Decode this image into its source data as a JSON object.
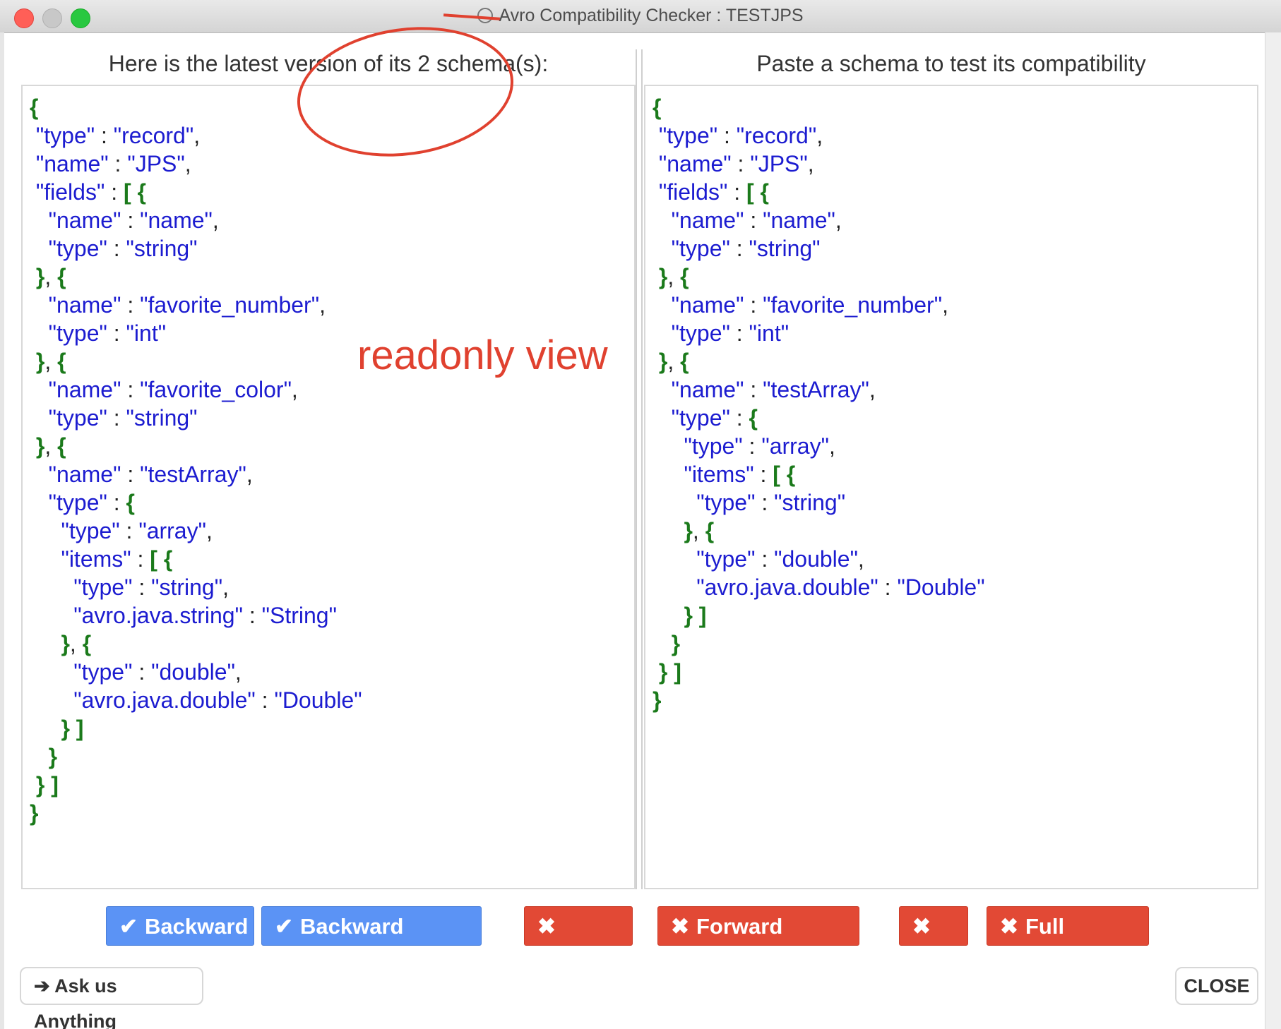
{
  "window": {
    "title": "Avro Compatibility Checker : TESTJPS"
  },
  "left_panel": {
    "header": "Here is the latest version of its 2 schema(s):",
    "code_lines": [
      [
        {
          "t": "p",
          "v": "{"
        }
      ],
      [
        {
          "t": "c",
          "v": " "
        },
        {
          "t": "k",
          "v": "\"type\""
        },
        {
          "t": "c",
          "v": " : "
        },
        {
          "t": "s",
          "v": "\"record\""
        },
        {
          "t": "c",
          "v": ","
        }
      ],
      [
        {
          "t": "c",
          "v": " "
        },
        {
          "t": "k",
          "v": "\"name\""
        },
        {
          "t": "c",
          "v": " : "
        },
        {
          "t": "s",
          "v": "\"JPS\""
        },
        {
          "t": "c",
          "v": ","
        }
      ],
      [
        {
          "t": "c",
          "v": " "
        },
        {
          "t": "k",
          "v": "\"fields\""
        },
        {
          "t": "c",
          "v": " : "
        },
        {
          "t": "p",
          "v": "[ {"
        }
      ],
      [
        {
          "t": "c",
          "v": "   "
        },
        {
          "t": "k",
          "v": "\"name\""
        },
        {
          "t": "c",
          "v": " : "
        },
        {
          "t": "s",
          "v": "\"name\""
        },
        {
          "t": "c",
          "v": ","
        }
      ],
      [
        {
          "t": "c",
          "v": "   "
        },
        {
          "t": "k",
          "v": "\"type\""
        },
        {
          "t": "c",
          "v": " : "
        },
        {
          "t": "s",
          "v": "\"string\""
        }
      ],
      [
        {
          "t": "c",
          "v": " "
        },
        {
          "t": "p",
          "v": "}"
        },
        {
          "t": "c",
          "v": ", "
        },
        {
          "t": "p",
          "v": "{"
        }
      ],
      [
        {
          "t": "c",
          "v": "   "
        },
        {
          "t": "k",
          "v": "\"name\""
        },
        {
          "t": "c",
          "v": " : "
        },
        {
          "t": "s",
          "v": "\"favorite_number\""
        },
        {
          "t": "c",
          "v": ","
        }
      ],
      [
        {
          "t": "c",
          "v": "   "
        },
        {
          "t": "k",
          "v": "\"type\""
        },
        {
          "t": "c",
          "v": " : "
        },
        {
          "t": "s",
          "v": "\"int\""
        }
      ],
      [
        {
          "t": "c",
          "v": " "
        },
        {
          "t": "p",
          "v": "}"
        },
        {
          "t": "c",
          "v": ", "
        },
        {
          "t": "p",
          "v": "{"
        }
      ],
      [
        {
          "t": "c",
          "v": "   "
        },
        {
          "t": "k",
          "v": "\"name\""
        },
        {
          "t": "c",
          "v": " : "
        },
        {
          "t": "s",
          "v": "\"favorite_color\""
        },
        {
          "t": "c",
          "v": ","
        }
      ],
      [
        {
          "t": "c",
          "v": "   "
        },
        {
          "t": "k",
          "v": "\"type\""
        },
        {
          "t": "c",
          "v": " : "
        },
        {
          "t": "s",
          "v": "\"string\""
        }
      ],
      [
        {
          "t": "c",
          "v": " "
        },
        {
          "t": "p",
          "v": "}"
        },
        {
          "t": "c",
          "v": ", "
        },
        {
          "t": "p",
          "v": "{"
        }
      ],
      [
        {
          "t": "c",
          "v": "   "
        },
        {
          "t": "k",
          "v": "\"name\""
        },
        {
          "t": "c",
          "v": " : "
        },
        {
          "t": "s",
          "v": "\"testArray\""
        },
        {
          "t": "c",
          "v": ","
        }
      ],
      [
        {
          "t": "c",
          "v": "   "
        },
        {
          "t": "k",
          "v": "\"type\""
        },
        {
          "t": "c",
          "v": " : "
        },
        {
          "t": "p",
          "v": "{"
        }
      ],
      [
        {
          "t": "c",
          "v": "     "
        },
        {
          "t": "k",
          "v": "\"type\""
        },
        {
          "t": "c",
          "v": " : "
        },
        {
          "t": "s",
          "v": "\"array\""
        },
        {
          "t": "c",
          "v": ","
        }
      ],
      [
        {
          "t": "c",
          "v": "     "
        },
        {
          "t": "k",
          "v": "\"items\""
        },
        {
          "t": "c",
          "v": " : "
        },
        {
          "t": "p",
          "v": "[ {"
        }
      ],
      [
        {
          "t": "c",
          "v": "       "
        },
        {
          "t": "k",
          "v": "\"type\""
        },
        {
          "t": "c",
          "v": " : "
        },
        {
          "t": "s",
          "v": "\"string\""
        },
        {
          "t": "c",
          "v": ","
        }
      ],
      [
        {
          "t": "c",
          "v": "       "
        },
        {
          "t": "k",
          "v": "\"avro.java.string\""
        },
        {
          "t": "c",
          "v": " : "
        },
        {
          "t": "s",
          "v": "\"String\""
        }
      ],
      [
        {
          "t": "c",
          "v": "     "
        },
        {
          "t": "p",
          "v": "}"
        },
        {
          "t": "c",
          "v": ", "
        },
        {
          "t": "p",
          "v": "{"
        }
      ],
      [
        {
          "t": "c",
          "v": "       "
        },
        {
          "t": "k",
          "v": "\"type\""
        },
        {
          "t": "c",
          "v": " : "
        },
        {
          "t": "s",
          "v": "\"double\""
        },
        {
          "t": "c",
          "v": ","
        }
      ],
      [
        {
          "t": "c",
          "v": "       "
        },
        {
          "t": "k",
          "v": "\"avro.java.double\""
        },
        {
          "t": "c",
          "v": " : "
        },
        {
          "t": "s",
          "v": "\"Double\""
        }
      ],
      [
        {
          "t": "c",
          "v": "     "
        },
        {
          "t": "p",
          "v": "} ]"
        }
      ],
      [
        {
          "t": "c",
          "v": "   "
        },
        {
          "t": "p",
          "v": "}"
        }
      ],
      [
        {
          "t": "c",
          "v": " "
        },
        {
          "t": "p",
          "v": "} ]"
        }
      ],
      [
        {
          "t": "p",
          "v": "}"
        }
      ]
    ]
  },
  "right_panel": {
    "header": "Paste a schema to test its compatibility",
    "code_lines": [
      [
        {
          "t": "p",
          "v": "{"
        }
      ],
      [
        {
          "t": "c",
          "v": " "
        },
        {
          "t": "k",
          "v": "\"type\""
        },
        {
          "t": "c",
          "v": " : "
        },
        {
          "t": "s",
          "v": "\"record\""
        },
        {
          "t": "c",
          "v": ","
        }
      ],
      [
        {
          "t": "c",
          "v": " "
        },
        {
          "t": "k",
          "v": "\"name\""
        },
        {
          "t": "c",
          "v": " : "
        },
        {
          "t": "s",
          "v": "\"JPS\""
        },
        {
          "t": "c",
          "v": ","
        }
      ],
      [
        {
          "t": "c",
          "v": " "
        },
        {
          "t": "k",
          "v": "\"fields\""
        },
        {
          "t": "c",
          "v": " : "
        },
        {
          "t": "p",
          "v": "[ {"
        }
      ],
      [
        {
          "t": "c",
          "v": "   "
        },
        {
          "t": "k",
          "v": "\"name\""
        },
        {
          "t": "c",
          "v": " : "
        },
        {
          "t": "s",
          "v": "\"name\""
        },
        {
          "t": "c",
          "v": ","
        }
      ],
      [
        {
          "t": "c",
          "v": "   "
        },
        {
          "t": "k",
          "v": "\"type\""
        },
        {
          "t": "c",
          "v": " : "
        },
        {
          "t": "s",
          "v": "\"string\""
        }
      ],
      [
        {
          "t": "c",
          "v": " "
        },
        {
          "t": "p",
          "v": "}"
        },
        {
          "t": "c",
          "v": ", "
        },
        {
          "t": "p",
          "v": "{"
        }
      ],
      [
        {
          "t": "c",
          "v": "   "
        },
        {
          "t": "k",
          "v": "\"name\""
        },
        {
          "t": "c",
          "v": " : "
        },
        {
          "t": "s",
          "v": "\"favorite_number\""
        },
        {
          "t": "c",
          "v": ","
        }
      ],
      [
        {
          "t": "c",
          "v": "   "
        },
        {
          "t": "k",
          "v": "\"type\""
        },
        {
          "t": "c",
          "v": " : "
        },
        {
          "t": "s",
          "v": "\"int\""
        }
      ],
      [
        {
          "t": "c",
          "v": " "
        },
        {
          "t": "p",
          "v": "}"
        },
        {
          "t": "c",
          "v": ", "
        },
        {
          "t": "p",
          "v": "{"
        }
      ],
      [
        {
          "t": "c",
          "v": "   "
        },
        {
          "t": "k",
          "v": "\"name\""
        },
        {
          "t": "c",
          "v": " : "
        },
        {
          "t": "s",
          "v": "\"testArray\""
        },
        {
          "t": "c",
          "v": ","
        }
      ],
      [
        {
          "t": "c",
          "v": "   "
        },
        {
          "t": "k",
          "v": "\"type\""
        },
        {
          "t": "c",
          "v": " : "
        },
        {
          "t": "p",
          "v": "{"
        }
      ],
      [
        {
          "t": "c",
          "v": "     "
        },
        {
          "t": "k",
          "v": "\"type\""
        },
        {
          "t": "c",
          "v": " : "
        },
        {
          "t": "s",
          "v": "\"array\""
        },
        {
          "t": "c",
          "v": ","
        }
      ],
      [
        {
          "t": "c",
          "v": "     "
        },
        {
          "t": "k",
          "v": "\"items\""
        },
        {
          "t": "c",
          "v": " : "
        },
        {
          "t": "p",
          "v": "[ {"
        }
      ],
      [
        {
          "t": "c",
          "v": "       "
        },
        {
          "t": "k",
          "v": "\"type\""
        },
        {
          "t": "c",
          "v": " : "
        },
        {
          "t": "s",
          "v": "\"string\""
        }
      ],
      [
        {
          "t": "c",
          "v": "     "
        },
        {
          "t": "p",
          "v": "}"
        },
        {
          "t": "c",
          "v": ", "
        },
        {
          "t": "p",
          "v": "{"
        }
      ],
      [
        {
          "t": "c",
          "v": "       "
        },
        {
          "t": "k",
          "v": "\"type\""
        },
        {
          "t": "c",
          "v": " : "
        },
        {
          "t": "s",
          "v": "\"double\""
        },
        {
          "t": "c",
          "v": ","
        }
      ],
      [
        {
          "t": "c",
          "v": "       "
        },
        {
          "t": "k",
          "v": "\"avro.java.double\""
        },
        {
          "t": "c",
          "v": " : "
        },
        {
          "t": "s",
          "v": "\"Double\""
        }
      ],
      [
        {
          "t": "c",
          "v": "     "
        },
        {
          "t": "p",
          "v": "} ]"
        }
      ],
      [
        {
          "t": "c",
          "v": "   "
        },
        {
          "t": "p",
          "v": "}"
        }
      ],
      [
        {
          "t": "c",
          "v": " "
        },
        {
          "t": "p",
          "v": "} ]"
        }
      ],
      [
        {
          "t": "p",
          "v": "}"
        }
      ]
    ]
  },
  "annotation": {
    "text": "readonly view",
    "color": "#e0412f"
  },
  "compat_buttons": [
    {
      "label": "Backward",
      "status": "ok",
      "icon": "check-icon"
    },
    {
      "label": "Backward Transitive",
      "status": "ok",
      "icon": "check-icon"
    },
    {
      "label": "Forward",
      "status": "bad",
      "icon": "x-icon"
    },
    {
      "label": "Forward Transitive",
      "status": "bad",
      "icon": "x-icon"
    },
    {
      "label": "Full",
      "status": "bad",
      "icon": "x-icon"
    },
    {
      "label": "Full Transitive",
      "status": "bad",
      "icon": "x-icon"
    }
  ],
  "footer": {
    "ask_label": "Ask us Anything",
    "close_label": "CLOSE"
  },
  "colors": {
    "ok": "#5b93f5",
    "bad": "#e24935",
    "key": "#1c1cd0",
    "punct": "#1b7a1b"
  }
}
